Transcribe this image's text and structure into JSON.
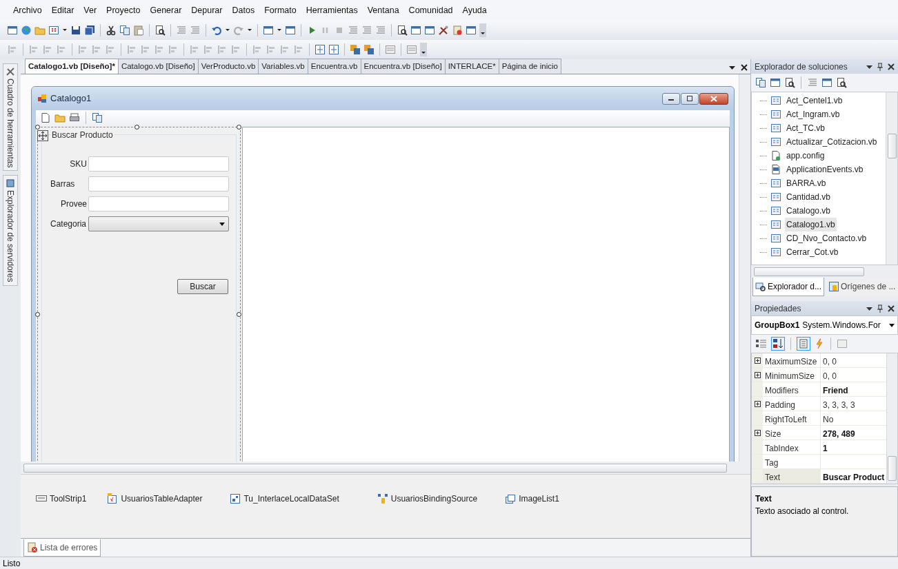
{
  "menu": [
    "Archivo",
    "Editar",
    "Ver",
    "Proyecto",
    "Generar",
    "Depurar",
    "Datos",
    "Formato",
    "Herramientas",
    "Ventana",
    "Comunidad",
    "Ayuda"
  ],
  "side_tabs": [
    "Cuadro de herramientas",
    "Explorador de servidores"
  ],
  "document_tabs": [
    {
      "label": "Catalogo1.vb [Diseño]*",
      "selected": true
    },
    {
      "label": "Catalogo.vb [Diseño]",
      "selected": false
    },
    {
      "label": "VerProducto.vb",
      "selected": false
    },
    {
      "label": "Variables.vb",
      "selected": false
    },
    {
      "label": "Encuentra.vb",
      "selected": false
    },
    {
      "label": "Encuentra.vb [Diseño]",
      "selected": false
    },
    {
      "label": "INTERLACE*",
      "selected": false
    },
    {
      "label": "Página de inicio",
      "selected": false
    }
  ],
  "designer": {
    "form_title": "Catalogo1",
    "group_title": "Buscar Producto",
    "fields": [
      {
        "kind": "text",
        "label": "SKU"
      },
      {
        "kind": "text",
        "label": "Barras"
      },
      {
        "kind": "text",
        "label": "Provee"
      },
      {
        "kind": "combo",
        "label": "Categoria"
      }
    ],
    "button": "Buscar"
  },
  "component_tray": [
    "ToolStrip1",
    "UsuariosTableAdapter",
    "Tu_InterlaceLocalDataSet",
    "UsuariosBindingSource",
    "ImageList1"
  ],
  "solution_explorer": {
    "title": "Explorador de soluciones",
    "files": [
      {
        "name": "Act_Centel1.vb",
        "kind": "form",
        "selected": false
      },
      {
        "name": "Act_Ingram.vb",
        "kind": "form",
        "selected": false
      },
      {
        "name": "Act_TC.vb",
        "kind": "form",
        "selected": false
      },
      {
        "name": "Actualizar_Cotizacion.vb",
        "kind": "form",
        "selected": false
      },
      {
        "name": "app.config",
        "kind": "config",
        "selected": false
      },
      {
        "name": "ApplicationEvents.vb",
        "kind": "module",
        "selected": false
      },
      {
        "name": "BARRA.vb",
        "kind": "form",
        "selected": false
      },
      {
        "name": "Cantidad.vb",
        "kind": "form",
        "selected": false
      },
      {
        "name": "Catalogo.vb",
        "kind": "form",
        "selected": false
      },
      {
        "name": "Catalogo1.vb",
        "kind": "form",
        "selected": true
      },
      {
        "name": "CD_Nvo_Contacto.vb",
        "kind": "form",
        "selected": false
      },
      {
        "name": "Cerrar_Cot.vb",
        "kind": "form",
        "selected": false
      }
    ],
    "tabs": [
      {
        "label": "Explorador d...",
        "selected": true
      },
      {
        "label": "Orígenes de ...",
        "selected": false
      }
    ]
  },
  "properties": {
    "title": "Propiedades",
    "object_name": "GroupBox1",
    "object_type": "System.Windows.For",
    "rows": [
      {
        "name": "MaximumSize",
        "value": "0, 0",
        "expandable": true,
        "modified": false,
        "selected": false
      },
      {
        "name": "MinimumSize",
        "value": "0, 0",
        "expandable": true,
        "modified": false,
        "selected": false
      },
      {
        "name": "Modifiers",
        "value": "Friend",
        "expandable": false,
        "modified": true,
        "selected": false
      },
      {
        "name": "Padding",
        "value": "3, 3, 3, 3",
        "expandable": true,
        "modified": false,
        "selected": false
      },
      {
        "name": "RightToLeft",
        "value": "No",
        "expandable": false,
        "modified": false,
        "selected": false
      },
      {
        "name": "Size",
        "value": "278, 489",
        "expandable": true,
        "modified": true,
        "selected": false
      },
      {
        "name": "TabIndex",
        "value": "1",
        "expandable": false,
        "modified": true,
        "selected": false
      },
      {
        "name": "Tag",
        "expandable": false,
        "selected": false
      },
      {
        "name": "Text",
        "value": "Buscar Product",
        "expandable": false,
        "modified": true,
        "selected": true
      }
    ],
    "description_title": "Text",
    "description": "Texto asociado al control."
  },
  "output_tabs": [
    "Lista de errores"
  ],
  "status_bar": "Listo"
}
